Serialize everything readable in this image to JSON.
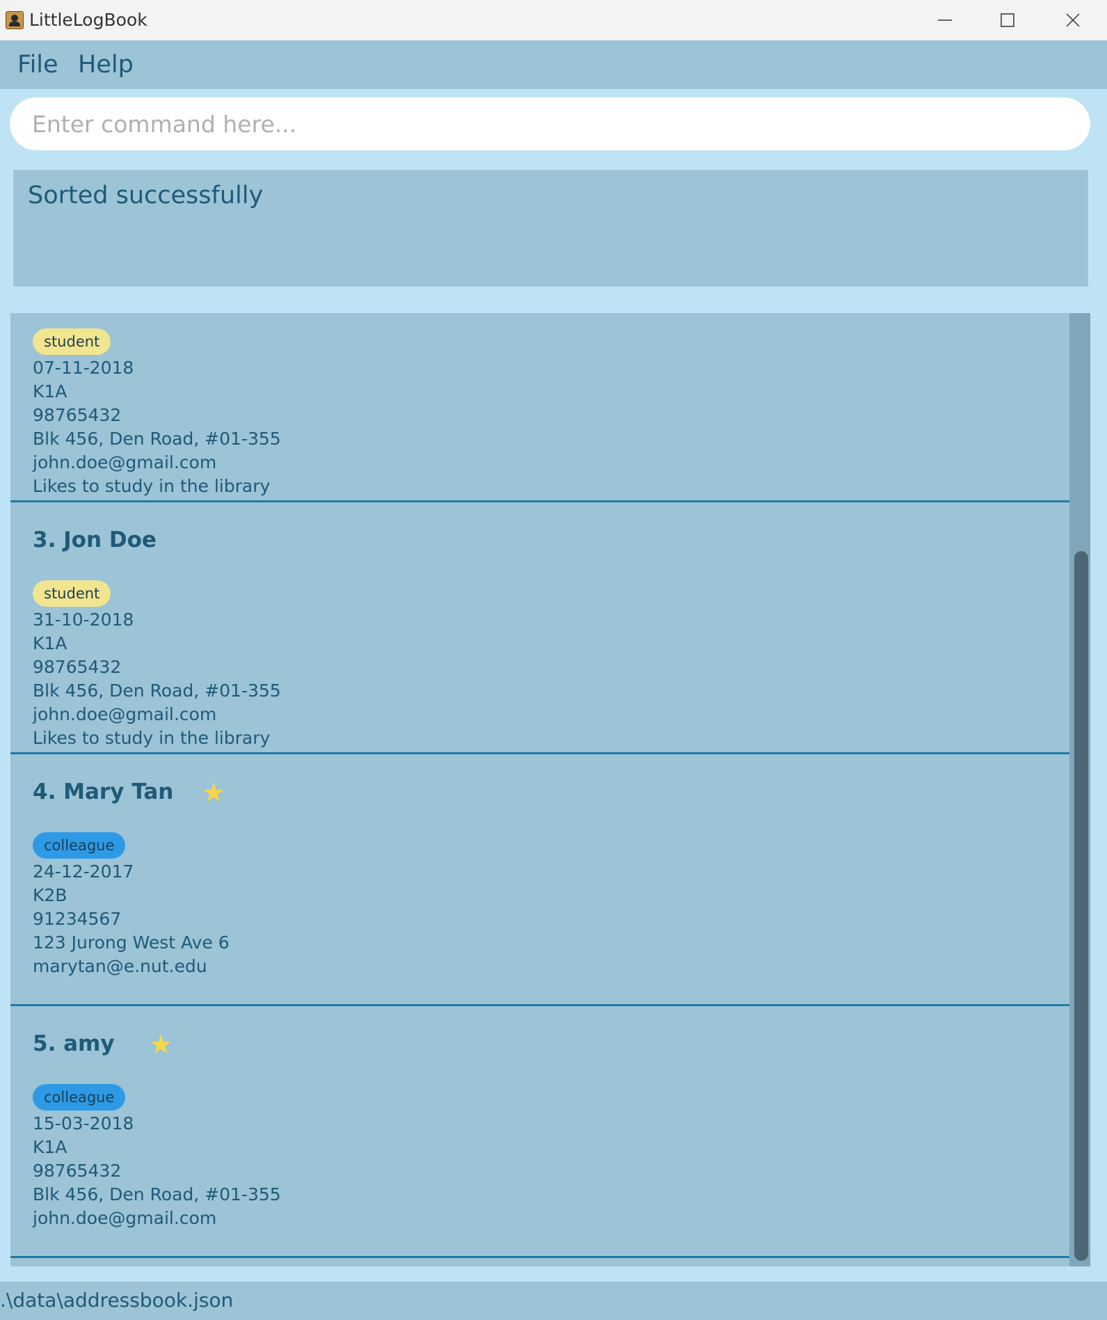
{
  "window": {
    "title": "LittleLogBook"
  },
  "menu": {
    "file": "File",
    "help": "Help"
  },
  "command": {
    "placeholder": "Enter command here..."
  },
  "result": {
    "message": "Sorted successfully"
  },
  "persons": [
    {
      "name": "",
      "favourite": false,
      "tag": "student",
      "date": "07-11-2018",
      "class": "K1A",
      "phone": "98765432",
      "address": "Blk 456, Den Road, #01-355",
      "email": "john.doe@gmail.com",
      "remark": "Likes to study in the library"
    },
    {
      "name": "3. Jon Doe",
      "favourite": false,
      "tag": "student",
      "date": "31-10-2018",
      "class": "K1A",
      "phone": "98765432",
      "address": "Blk 456, Den Road, #01-355",
      "email": "john.doe@gmail.com",
      "remark": "Likes to study in the library"
    },
    {
      "name": "4. Mary Tan",
      "favourite": true,
      "tag": "colleague",
      "date": "24-12-2017",
      "class": "K2B",
      "phone": "91234567",
      "address": "123 Jurong West Ave 6",
      "email": "marytan@e.nut.edu",
      "remark": ""
    },
    {
      "name": "5. amy",
      "favourite": true,
      "tag": "colleague",
      "date": "15-03-2018",
      "class": "K1A",
      "phone": "98765432",
      "address": "Blk 456, Den Road, #01-355",
      "email": "john.doe@gmail.com",
      "remark": ""
    }
  ],
  "status": {
    "file_path": ".\\data\\addressbook.json"
  },
  "colors": {
    "accent": "#1f5a78",
    "panel": "#9cc3d6",
    "background": "#bde3f4",
    "divider": "#1f7aa6",
    "star": "#f7d64a",
    "tag_student": "#f2e58f",
    "tag_colleague": "#2e9ae6"
  },
  "icons": {
    "app": "address-book-icon",
    "favourite": "star-icon",
    "minimize": "minimize-icon",
    "maximize": "maximize-icon",
    "close": "close-icon"
  }
}
